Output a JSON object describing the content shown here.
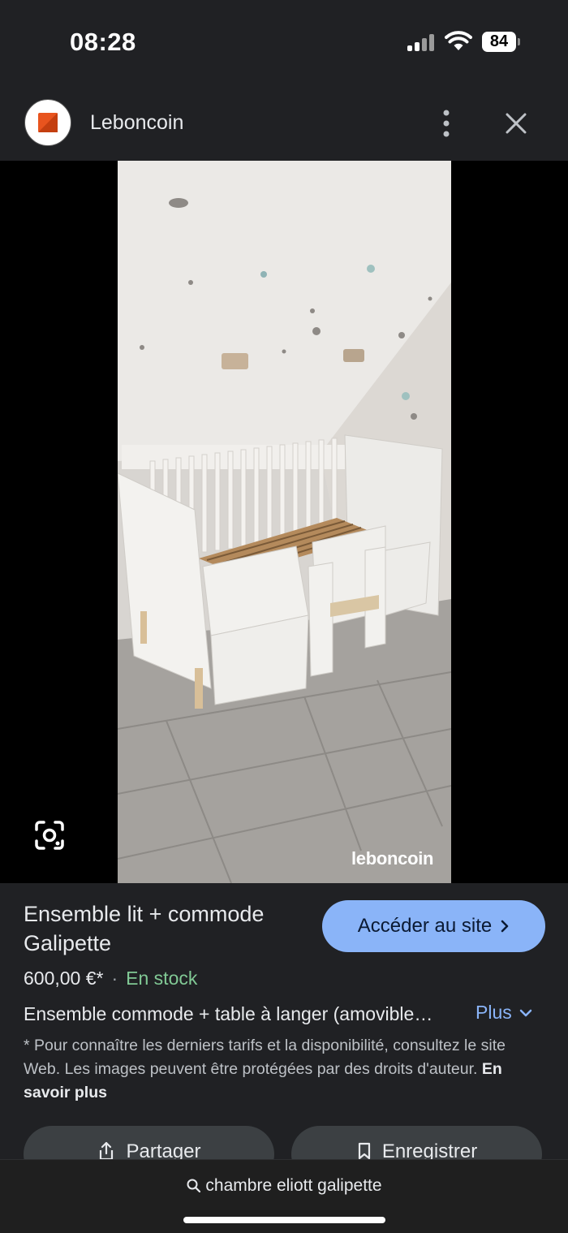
{
  "status_bar": {
    "time": "08:28",
    "battery": "84"
  },
  "header": {
    "site_name": "Leboncoin"
  },
  "image": {
    "watermark": "leboncoin"
  },
  "product": {
    "title": "Ensemble lit + commode Galipette",
    "visit_label": "Accéder au site",
    "price": "600,00 €*",
    "separator": "·",
    "stock": "En stock",
    "description": "Ensemble commode + table à langer (amovible…",
    "more_label": "Plus",
    "disclaimer": "* Pour connaître les derniers tarifs et la disponibilité, consultez le site Web. Les images peuvent être protégées par des droits d'auteur.",
    "learn_more": "En savoir plus"
  },
  "actions": {
    "share_label": "Partager",
    "save_label": "Enregistrer"
  },
  "bottom": {
    "query": "chambre eliott galipette"
  },
  "colors": {
    "accent": "#8ab4f8",
    "stock": "#81c995",
    "background": "#202124",
    "brand": "#e8541e"
  }
}
